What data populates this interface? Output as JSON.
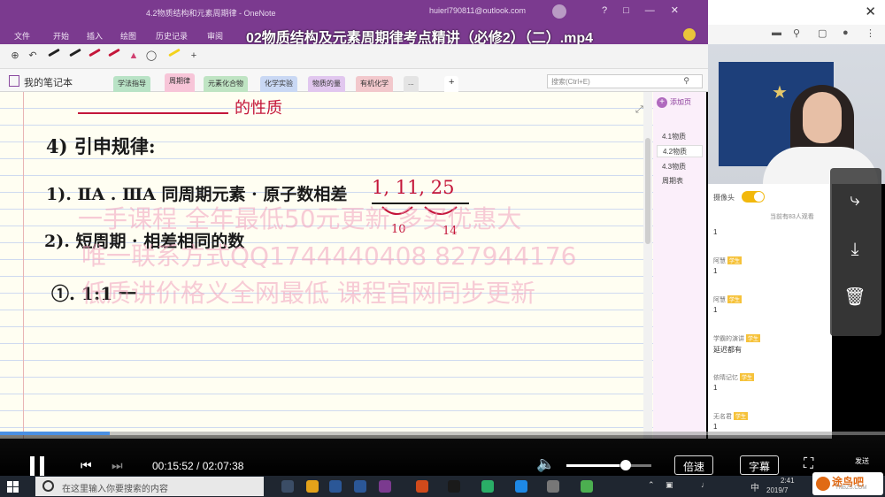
{
  "onenote": {
    "window_title": "4.2物质结构和元素周期律 - OneNote",
    "account": "huierl790811@outlook.com",
    "menu": [
      "文件",
      "开始",
      "插入",
      "绘图",
      "历史记录",
      "审阅"
    ],
    "notebook_name": "我的笔记本",
    "section_tabs": [
      "学法指导",
      "周期律",
      "元素化合物",
      "化学实验",
      "物质的量",
      "有机化学",
      "..."
    ],
    "active_section": "周期律",
    "search_placeholder": "搜索(Ctrl+E)",
    "add_page": "添加页",
    "pages": [
      "4.1物质",
      "4.2物质",
      "4.3物质",
      "周期表"
    ],
    "selected_page": "4.2物质"
  },
  "video": {
    "title": "02物质结构及元素周期律考点精讲（必修2）（二）.mp4",
    "current_time": "00:15:52",
    "total_time": "02:07:38",
    "progress": 0.124,
    "volume": 0.63,
    "speed_button": "倍速",
    "subtitle_button": "字幕",
    "send_label": "发送"
  },
  "handwriting": {
    "heading_tail": "的性质",
    "line1": "4) 引申规律:",
    "line2": "1). ⅡA . ⅢA 同周期元素 · 原子数相差",
    "numbers_top": "1,  11,  25",
    "numbers_bottom_a": "10",
    "numbers_bottom_b": "14",
    "line3": "2). 短周期 · 相差相同的数",
    "line4": "①. 1:1 一"
  },
  "watermark": {
    "line1": "一手课程   全年最低50元更新  多买优惠大",
    "line2": "唯一联系方式QQ1744440408   827944176",
    "line3": "低质讲价格义全网最低  课程官网同步更新"
  },
  "live_panel": {
    "camera_label": "摄像头",
    "viewers": "当前有83人观看",
    "messages": [
      {
        "name": "",
        "badge": "",
        "text": "1"
      },
      {
        "name": "阿慧",
        "badge": "学生",
        "text": "1"
      },
      {
        "name": "阿慧",
        "badge": "学生",
        "text": "1"
      },
      {
        "name": "学霸的演讲",
        "badge": "学生",
        "text": "延迟都有"
      },
      {
        "name": "依晴记忆",
        "badge": "学生",
        "text": "1"
      },
      {
        "name": "无名君",
        "badge": "学生",
        "text": "1"
      }
    ]
  },
  "taskbar": {
    "search_placeholder": "在这里输入你要搜索的内容",
    "ime": "中",
    "time": "2:41",
    "date": "2019/7"
  },
  "site_badge": {
    "brand": "途鸟吧",
    "domain": "TNBZS.COM"
  },
  "colors": {
    "onenote_purple": "#7b3a8f",
    "pen_red": "#c4163a",
    "progress_blue": "#4a90e2",
    "toggle_yellow": "#f2b80c"
  },
  "icons": [
    "share-icon",
    "download-icon",
    "trash-icon",
    "close-icon",
    "volume-icon",
    "fullscreen-icon",
    "pause-icon"
  ]
}
